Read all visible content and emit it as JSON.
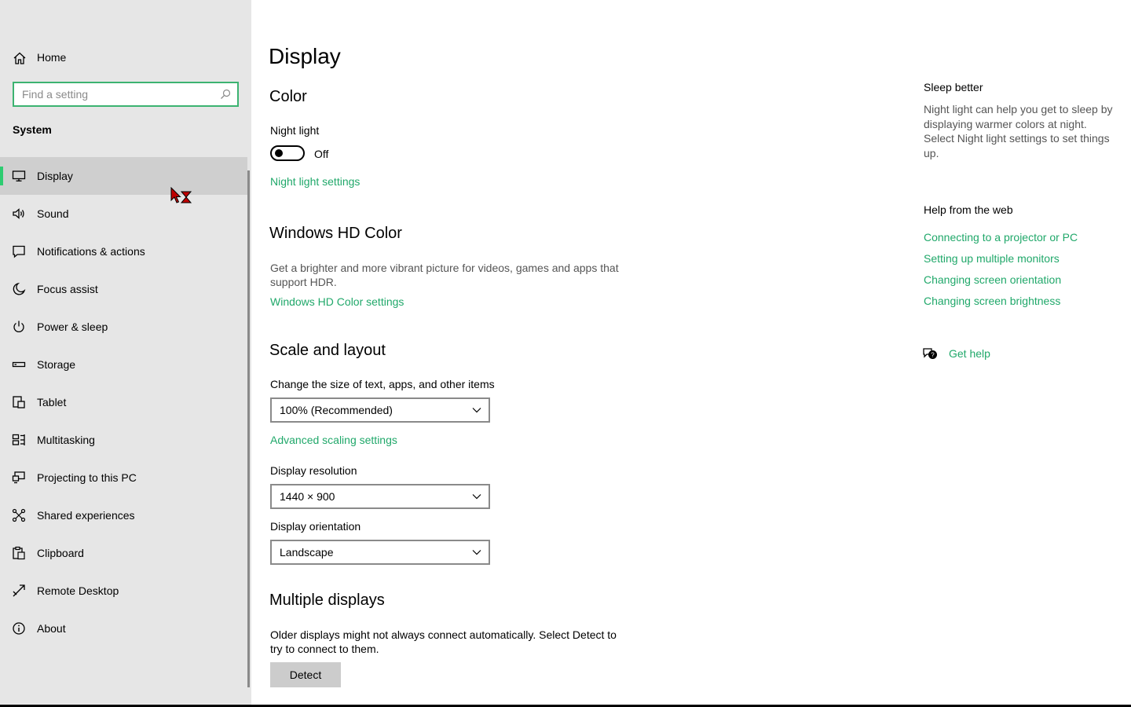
{
  "sidebar": {
    "home_label": "Home",
    "search_placeholder": "Find a setting",
    "section": "System",
    "items": [
      {
        "label": "Display",
        "icon": "monitor-icon",
        "selected": true
      },
      {
        "label": "Sound",
        "icon": "speaker-icon"
      },
      {
        "label": "Notifications & actions",
        "icon": "notification-icon"
      },
      {
        "label": "Focus assist",
        "icon": "moon-icon"
      },
      {
        "label": "Power & sleep",
        "icon": "power-icon"
      },
      {
        "label": "Storage",
        "icon": "storage-icon"
      },
      {
        "label": "Tablet",
        "icon": "tablet-icon"
      },
      {
        "label": "Multitasking",
        "icon": "multitasking-icon"
      },
      {
        "label": "Projecting to this PC",
        "icon": "projecting-icon"
      },
      {
        "label": "Shared experiences",
        "icon": "shared-icon"
      },
      {
        "label": "Clipboard",
        "icon": "clipboard-icon"
      },
      {
        "label": "Remote Desktop",
        "icon": "remote-desktop-icon"
      },
      {
        "label": "About",
        "icon": "info-icon"
      }
    ]
  },
  "main": {
    "title": "Display",
    "color": {
      "heading": "Color",
      "night_light_label": "Night light",
      "night_light_state": "Off",
      "night_light_on": false,
      "night_light_link": "Night light settings"
    },
    "hdr": {
      "heading": "Windows HD Color",
      "description": "Get a brighter and more vibrant picture for videos, games and apps that support HDR.",
      "link": "Windows HD Color settings"
    },
    "scale": {
      "heading": "Scale and layout",
      "size_label": "Change the size of text, apps, and other items",
      "size_value": "100% (Recommended)",
      "advanced_link": "Advanced scaling settings",
      "resolution_label": "Display resolution",
      "resolution_value": "1440 × 900",
      "orientation_label": "Display orientation",
      "orientation_value": "Landscape"
    },
    "multiple": {
      "heading": "Multiple displays",
      "description": "Older displays might not always connect automatically. Select Detect to try to connect to them.",
      "detect_button": "Detect"
    }
  },
  "right": {
    "sleep_heading": "Sleep better",
    "sleep_text": "Night light can help you get to sleep by displaying warmer colors at night. Select Night light settings to set things up.",
    "help_heading": "Help from the web",
    "help_links": [
      "Connecting to a projector or PC",
      "Setting up multiple monitors",
      "Changing screen orientation",
      "Changing screen brightness"
    ],
    "get_help": "Get help"
  },
  "colors": {
    "accent": "#2ecc71",
    "link": "#20a86a",
    "sidebar_bg": "#e6e6e6"
  }
}
